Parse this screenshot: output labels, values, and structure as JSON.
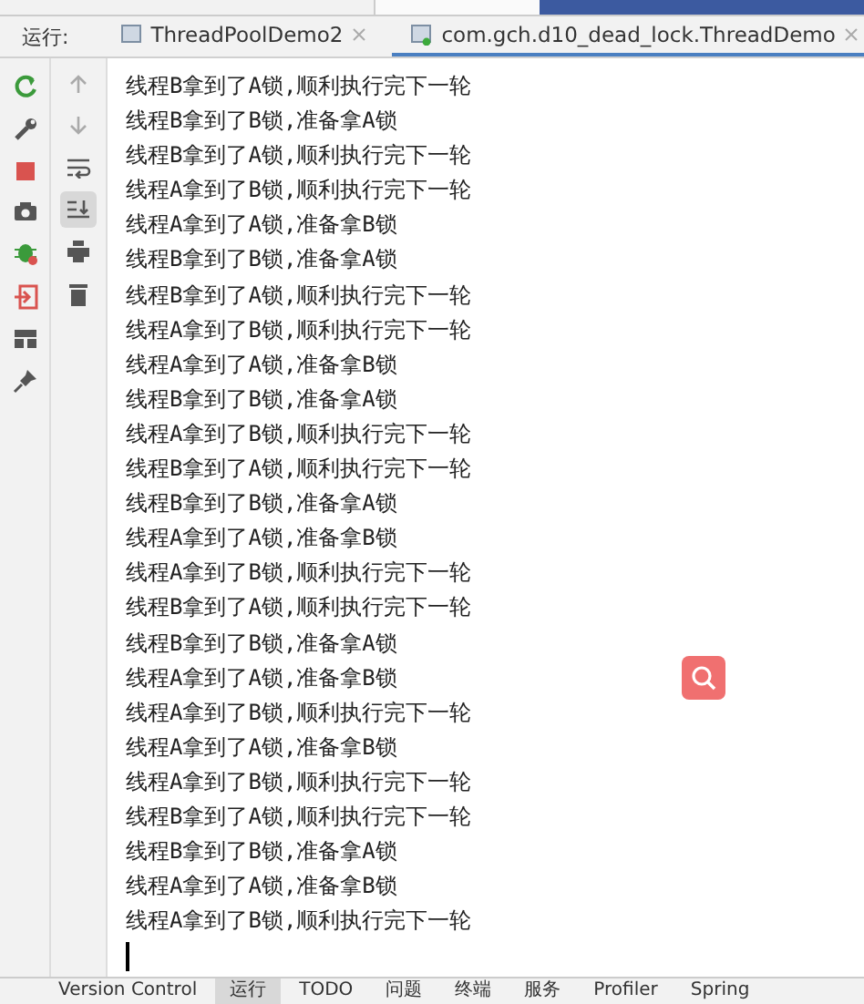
{
  "run_panel": {
    "label": "运行:",
    "tabs": [
      {
        "label": "ThreadPoolDemo2",
        "selected": false,
        "running": false
      },
      {
        "label": "com.gch.d10_dead_lock.ThreadDemo",
        "selected": true,
        "running": true
      }
    ]
  },
  "toolbar_secondary": [
    {
      "kind": "up",
      "selected": false
    },
    {
      "kind": "down",
      "selected": false
    },
    {
      "kind": "wrap",
      "selected": false
    },
    {
      "kind": "scroll",
      "selected": true
    },
    {
      "kind": "print",
      "selected": false
    },
    {
      "kind": "trash",
      "selected": false
    }
  ],
  "console": {
    "lines": [
      "线程B拿到了A锁,顺利执行完下一轮",
      "线程B拿到了B锁,准备拿A锁",
      "线程B拿到了A锁,顺利执行完下一轮",
      "线程A拿到了B锁,顺利执行完下一轮",
      "线程A拿到了A锁,准备拿B锁",
      "线程B拿到了B锁,准备拿A锁",
      "线程B拿到了A锁,顺利执行完下一轮",
      "线程A拿到了B锁,顺利执行完下一轮",
      "线程A拿到了A锁,准备拿B锁",
      "线程B拿到了B锁,准备拿A锁",
      "线程A拿到了B锁,顺利执行完下一轮",
      "线程B拿到了A锁,顺利执行完下一轮",
      "线程B拿到了B锁,准备拿A锁",
      "线程A拿到了A锁,准备拿B锁",
      "线程A拿到了B锁,顺利执行完下一轮",
      "线程B拿到了A锁,顺利执行完下一轮",
      "线程B拿到了B锁,准备拿A锁",
      "线程A拿到了A锁,准备拿B锁",
      "线程A拿到了B锁,顺利执行完下一轮",
      "线程A拿到了A锁,准备拿B锁",
      "线程A拿到了B锁,顺利执行完下一轮",
      "线程B拿到了A锁,顺利执行完下一轮",
      "线程B拿到了B锁,准备拿A锁",
      "线程A拿到了A锁,准备拿B锁",
      "线程A拿到了B锁,顺利执行完下一轮"
    ]
  },
  "bottom_tabs": [
    {
      "label": "Version Control",
      "selected": false
    },
    {
      "label": "运行",
      "selected": true
    },
    {
      "label": "TODO",
      "selected": false
    },
    {
      "label": "问题",
      "selected": false
    },
    {
      "label": "终端",
      "selected": false
    },
    {
      "label": "服务",
      "selected": false
    },
    {
      "label": "Profiler",
      "selected": false
    },
    {
      "label": "Spring",
      "selected": false
    }
  ]
}
